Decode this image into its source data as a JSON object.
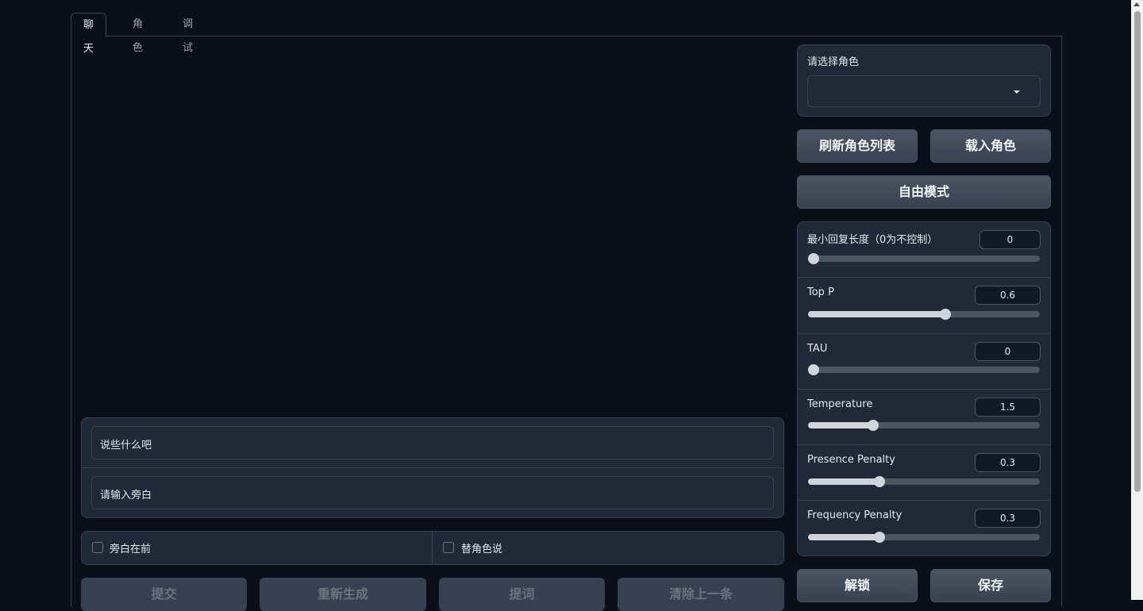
{
  "tabs": [
    {
      "label": "聊天",
      "active": true
    },
    {
      "label": "角色",
      "active": false
    },
    {
      "label": "调试",
      "active": false
    }
  ],
  "character_select": {
    "label": "请选择角色",
    "value": "",
    "icon": "caret-down-icon"
  },
  "buttons": {
    "refresh": "刷新角色列表",
    "load": "载入角色",
    "free_mode": "自由模式",
    "unlock": "解锁",
    "save": "保存",
    "submit": "提交",
    "regenerate": "重新生成",
    "prompt": "提词",
    "clear_last": "清除上一条"
  },
  "chat_input": {
    "placeholder": "说些什么吧"
  },
  "narration_input": {
    "placeholder": "请输入旁白"
  },
  "checkboxes": [
    {
      "label": "旁白在前",
      "checked": false
    },
    {
      "label": "替角色说",
      "checked": false
    }
  ],
  "params": [
    {
      "label": "最小回复长度（0为不控制）",
      "value": "0",
      "fraction": 0.0
    },
    {
      "label": "Top P",
      "value": "0.6",
      "fraction": 0.6
    },
    {
      "label": "TAU",
      "value": "0",
      "fraction": 0.0
    },
    {
      "label": "Temperature",
      "value": "1.5",
      "fraction": 0.29
    },
    {
      "label": "Presence Penalty",
      "value": "0.3",
      "fraction": 0.31
    },
    {
      "label": "Frequency Penalty",
      "value": "0.3",
      "fraction": 0.31
    }
  ],
  "colors": {
    "background": "#0b0f19",
    "panel": "#1f2937",
    "border": "#374151",
    "slider_fill": "#d1d5db"
  }
}
